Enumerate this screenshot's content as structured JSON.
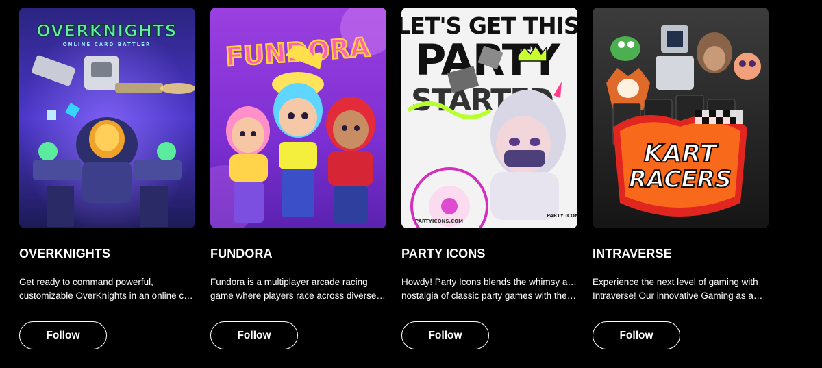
{
  "games": [
    {
      "title": "OVERKNIGHTS",
      "desc_line1": "Get ready to command powerful,",
      "desc_line2": "customizable OverKnights in an online car…",
      "follow_label": "Follow",
      "art": {
        "logo": "OVERKNIGHTS",
        "tagline": "ONLINE CARD BATTLER",
        "colors": [
          "#3b2fbf",
          "#6a3fe0",
          "#1b1456"
        ]
      }
    },
    {
      "title": "FUNDORA",
      "desc_line1": "Fundora is a multiplayer arcade racing",
      "desc_line2": "game where players race across diverse…",
      "follow_label": "Follow",
      "art": {
        "logo": "FUNDORA",
        "colors": [
          "#b24fe6",
          "#7b2ed6",
          "#e27bf0"
        ]
      }
    },
    {
      "title": "PARTY ICONS",
      "desc_line1": "Howdy! Party Icons blends the whimsy and",
      "desc_line2": "nostalgia of classic party games with the…",
      "follow_label": "Follow",
      "art": {
        "headline_1": "LET'S GET THIS",
        "headline_2": "PARTY",
        "headline_3": "STARTED",
        "site": "PARTYICONS.COM",
        "brand": "PARTY ICONS",
        "colors": [
          "#f4f4f4",
          "#111111",
          "#b8ff2e"
        ]
      }
    },
    {
      "title": "INTRAVERSE",
      "desc_line1": "Experience the next level of gaming with",
      "desc_line2": "Intraverse! Our innovative Gaming as a…",
      "follow_label": "Follow",
      "art": {
        "logo_1": "KART",
        "logo_2": "RACERS",
        "colors": [
          "#3a3a3a",
          "#1c1c1c",
          "#e0261f"
        ]
      }
    }
  ]
}
